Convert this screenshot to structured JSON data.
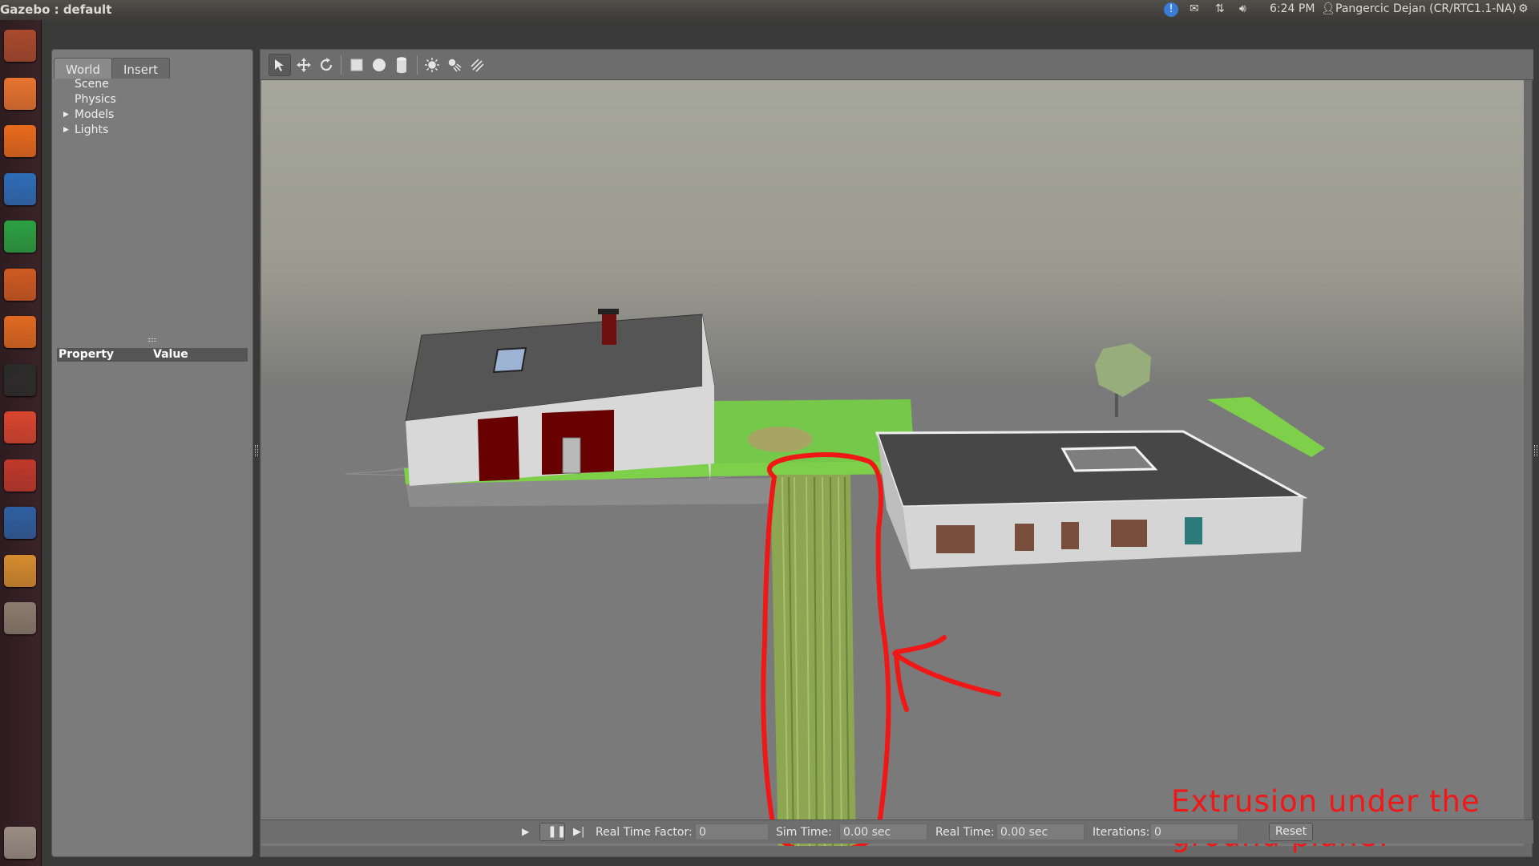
{
  "topbar": {
    "title": "Gazebo : default",
    "time": "6:24 PM",
    "user": "Pangercic Dejan (CR/RTC1.1-NA)",
    "indicators": [
      "info-icon",
      "mail-icon",
      "network-icon",
      "volume-icon",
      "user-icon",
      "settings-gear-icon"
    ]
  },
  "launcher": {
    "items": [
      {
        "name": "ubuntu-dash-icon",
        "color": "#a94a2d"
      },
      {
        "name": "files-folder-icon",
        "color": "#e8742f"
      },
      {
        "name": "firefox-icon",
        "color": "#e86a1c"
      },
      {
        "name": "libreoffice-writer-icon",
        "color": "#2d6db7"
      },
      {
        "name": "libreoffice-calc-icon",
        "color": "#2aa142"
      },
      {
        "name": "libreoffice-impress-icon",
        "color": "#cf5a22"
      },
      {
        "name": "software-center-icon",
        "color": "#e0691f"
      },
      {
        "name": "terminal-icon",
        "color": "#2b2b2b"
      },
      {
        "name": "chrome-icon",
        "color": "#d9452e"
      },
      {
        "name": "system-settings-icon",
        "color": "#c0392b"
      },
      {
        "name": "thunderbird-icon",
        "color": "#2e5fa1"
      },
      {
        "name": "package-box-icon",
        "color": "#d58c2e"
      },
      {
        "name": "window-manager-icon",
        "color": "#8a7c6e"
      },
      {
        "name": "trash-icon",
        "color": "#9a8e84"
      }
    ]
  },
  "left_panel": {
    "tabs": [
      "World",
      "Insert"
    ],
    "active_tab": "World",
    "tree": [
      {
        "label": "Scene",
        "expandable": false
      },
      {
        "label": "Physics",
        "expandable": false
      },
      {
        "label": "Models",
        "expandable": true
      },
      {
        "label": "Lights",
        "expandable": true
      }
    ],
    "property_header": {
      "property": "Property",
      "value": "Value"
    }
  },
  "toolbar": {
    "tools": [
      "select-arrow-icon",
      "translate-icon",
      "rotate-icon",
      "box-icon",
      "sphere-icon",
      "cylinder-icon",
      "point-light-icon",
      "spot-light-icon",
      "directional-light-icon"
    ]
  },
  "statusbar": {
    "real_time_factor_label": "Real Time Factor:",
    "real_time_factor": "0",
    "sim_time_label": "Sim Time:",
    "sim_time": "0.00 sec",
    "real_time_label": "Real Time:",
    "real_time": "0.00 sec",
    "iterations_label": "Iterations:",
    "iterations": "0",
    "reset_label": "Reset"
  },
  "annotation": {
    "text": "Extrusion under the ground plane!",
    "color": "#f01717"
  }
}
